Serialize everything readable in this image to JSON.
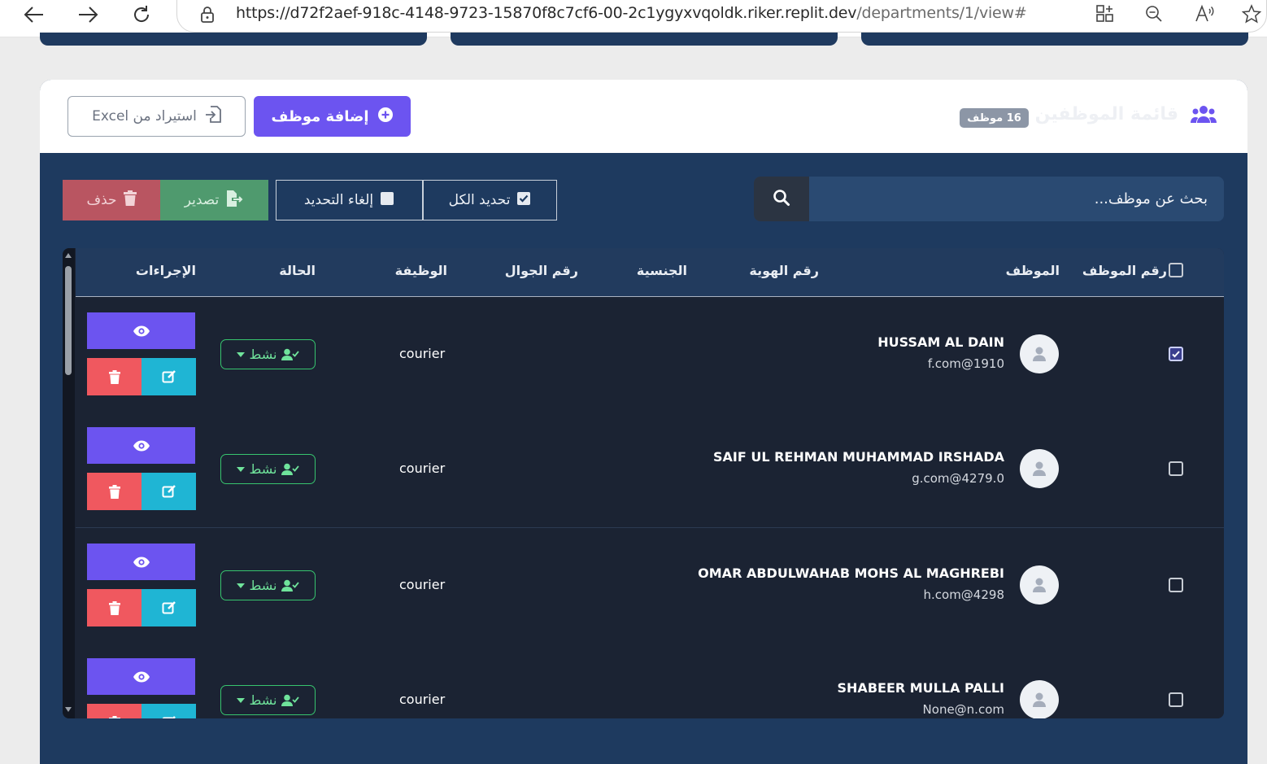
{
  "browser": {
    "url_host": "https://d72f2aef-918c-4148-9723-15870f8c7cf6-00-2c1ygyxvqoldk.riker.replit.dev",
    "url_path": "/departments/1/view#"
  },
  "panel": {
    "title": "قائمة الموظفين",
    "count_badge": "16 موظف",
    "add_button": "إضافة موظف",
    "import_button": "استيراد من Excel"
  },
  "toolbar": {
    "search_placeholder": "بحث عن موظف...",
    "select_all": "تحديد الكل",
    "deselect": "إلغاء التحديد",
    "export": "تصدير",
    "delete": "حذف"
  },
  "table": {
    "headers": {
      "emp_no": "رقم الموظف",
      "employee": "الموظف",
      "id_no": "رقم الهوية",
      "nationality": "الجنسية",
      "mobile": "رقم الجوال",
      "job": "الوظيفة",
      "status": "الحالة",
      "actions": "الإجراءات"
    },
    "rows": [
      {
        "name": "HUSSAM AL DAIN",
        "email": "f.com@1910",
        "job": "courier",
        "status": "نشط",
        "checked": true
      },
      {
        "name": "SAIF UL REHMAN MUHAMMAD IRSHADA",
        "email": "g.com@4279.0",
        "job": "courier",
        "status": "نشط",
        "checked": false
      },
      {
        "name": "OMAR ABDULWAHAB MOHS AL MAGHREBI",
        "email": "h.com@4298",
        "job": "courier",
        "status": "نشط",
        "checked": false
      },
      {
        "name": "SHABEER MULLA PALLI",
        "email": "None@n.com",
        "job": "courier",
        "status": "نشط",
        "checked": false
      }
    ]
  },
  "colors": {
    "panel_bg": "#1e3a5f",
    "accent_purple": "#6c54f0",
    "status_green": "#37c46e",
    "edit_cyan": "#1fb5d4",
    "delete_red": "#f0585f"
  }
}
